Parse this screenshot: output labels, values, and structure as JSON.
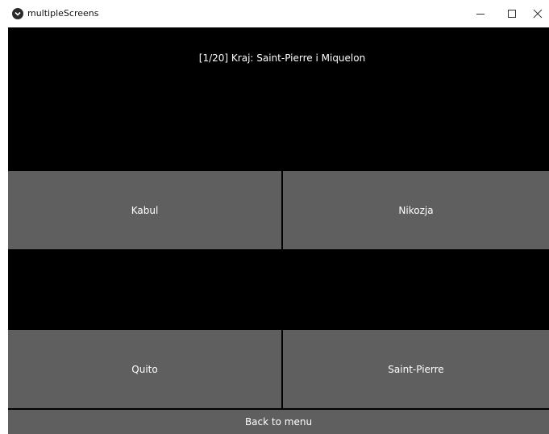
{
  "window": {
    "title": "multipleScreens",
    "minimize_glyph": "–",
    "maximize_glyph": "☐",
    "close_glyph": "✕"
  },
  "quiz": {
    "question": "[1/20] Kraj: Saint-Pierre i Miquelon",
    "answers": [
      {
        "label": "Kabul"
      },
      {
        "label": "Nikozja"
      },
      {
        "label": "Quito"
      },
      {
        "label": "Saint-Pierre"
      }
    ],
    "back_label": "Back to menu"
  },
  "colors": {
    "background": "#000000",
    "button": "#5f5f5f",
    "text": "#ffffff"
  }
}
